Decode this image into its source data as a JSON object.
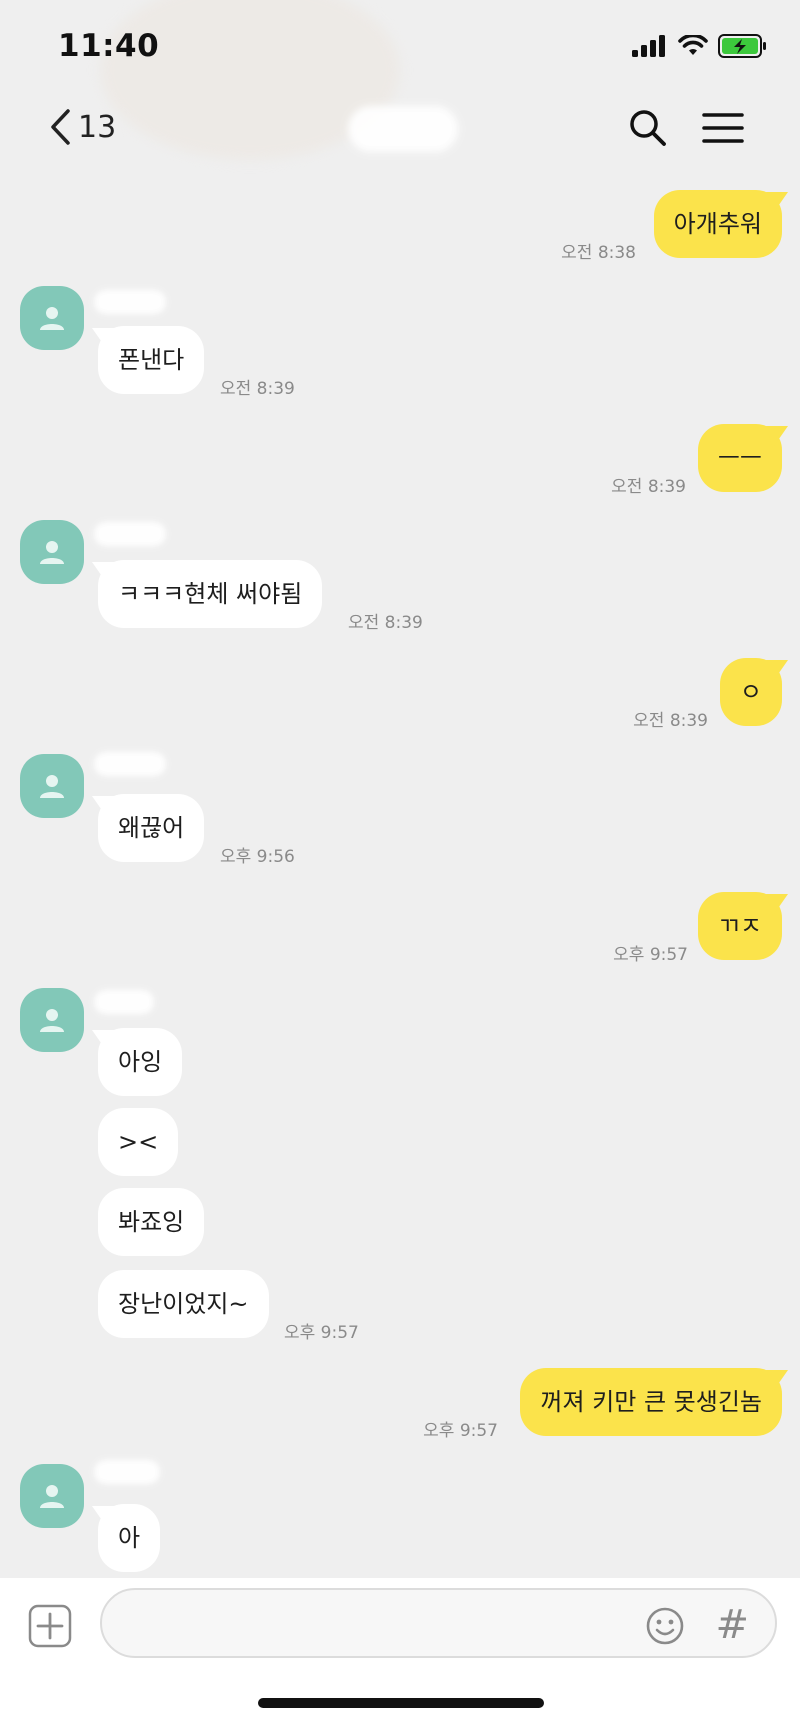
{
  "status_bar": {
    "time": "11:40"
  },
  "header": {
    "back_count": "13"
  },
  "messages": [
    {
      "text": "아개추워",
      "time": "오전 8:38"
    },
    {
      "text": "폰낸다",
      "time": "오전 8:39"
    },
    {
      "text": "ㅡㅡ",
      "time": "오전 8:39"
    },
    {
      "text": "ㅋㅋㅋ현체 써야됨",
      "time": "오전 8:39"
    },
    {
      "text": "ㅇ",
      "time": "오전 8:39"
    },
    {
      "text": "왜끊어",
      "time": "오후 9:56"
    },
    {
      "text": "ㄲㅈ",
      "time": "오후 9:57"
    },
    {
      "text": "아잉"
    },
    {
      "text": "><"
    },
    {
      "text": "봐죠잉"
    },
    {
      "text": "장난이었지~",
      "time": "오후 9:57"
    },
    {
      "text": "꺼져 키만 큰 못생긴놈",
      "time": "오후 9:57"
    },
    {
      "text": "아"
    }
  ],
  "input": {
    "hash_label": "#"
  },
  "colors": {
    "my_bubble": "#fbe34b",
    "their_bubble": "#ffffff",
    "avatar": "#82c8b8",
    "background": "#efefef"
  }
}
